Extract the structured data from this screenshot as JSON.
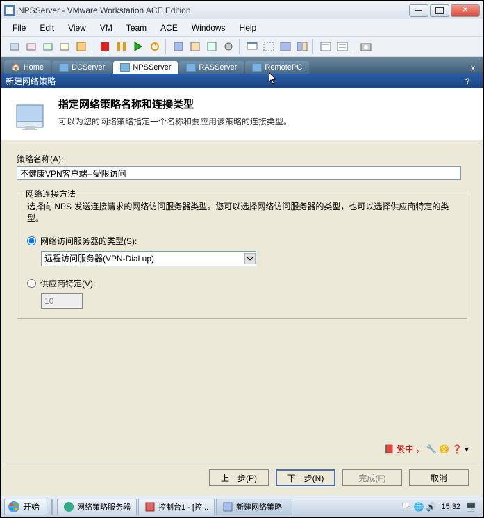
{
  "window": {
    "title": "NPSServer - VMware Workstation ACE Edition"
  },
  "menubar": [
    "File",
    "Edit",
    "View",
    "VM",
    "Team",
    "ACE",
    "Windows",
    "Help"
  ],
  "vm_tabs": [
    {
      "label": "Home",
      "active": false
    },
    {
      "label": "DCServer",
      "active": false
    },
    {
      "label": "NPSServer",
      "active": true
    },
    {
      "label": "RASServer",
      "active": false
    },
    {
      "label": "RemotePC",
      "active": false
    }
  ],
  "wizard": {
    "titlebar": "新建网络策略",
    "header_title": "指定网络策略名称和连接类型",
    "header_desc": "可以为您的网络策略指定一个名称和要应用该策略的连接类型。",
    "policy_name_label": "策略名称(A):",
    "policy_name_value": "不健康VPN客户端--受限访问",
    "group_title": "网络连接方法",
    "group_desc": "选择向 NPS 发送连接请求的网络访问服务器类型。您可以选择网络访问服务器的类型，也可以选择供应商特定的类型。",
    "radio1_label": "网络访问服务器的类型(S):",
    "radio1_value": "远程访问服务器(VPN-Dial up)",
    "radio2_label": "供应商特定(V):",
    "radio2_value": "10",
    "tray_text": "繁中 ，",
    "buttons": {
      "prev": "上一步(P)",
      "next": "下一步(N)",
      "finish": "完成(F)",
      "cancel": "取消"
    }
  },
  "taskbar": {
    "start": "开始",
    "tasks": [
      {
        "label": "网络策略服务器"
      },
      {
        "label": "控制台1 - [控..."
      },
      {
        "label": "新建网络策略",
        "active": true
      }
    ],
    "clock": "15:32"
  }
}
